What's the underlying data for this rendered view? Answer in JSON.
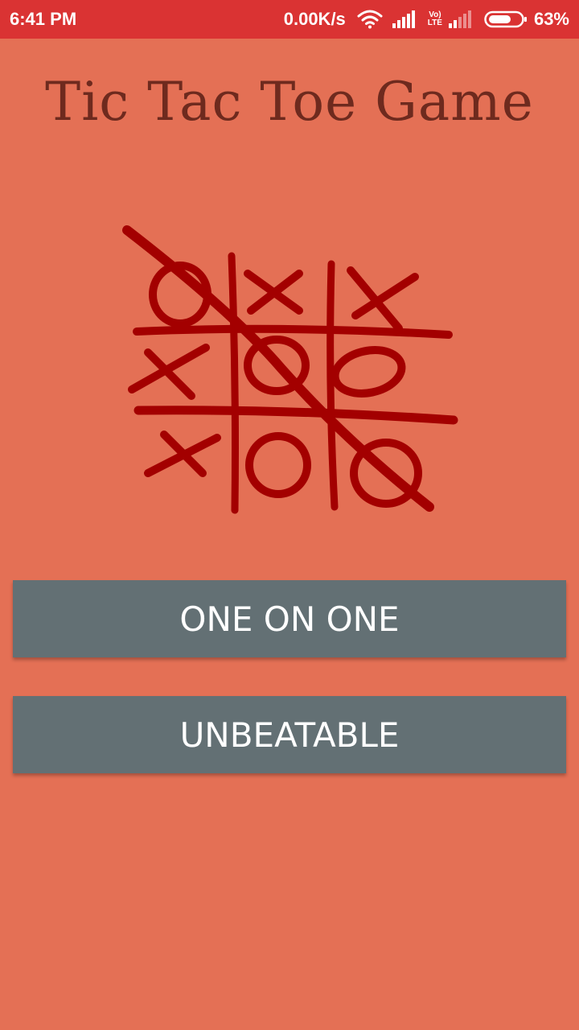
{
  "status_bar": {
    "time": "6:41 PM",
    "net_speed": "0.00K/s",
    "lte_top": "Vo)",
    "lte_bottom": "LTE",
    "battery_percent": "63%",
    "icons": [
      "wifi-icon",
      "signal-icon",
      "lte-icon",
      "signal-2-icon",
      "battery-icon"
    ],
    "background_color": "#DA3333"
  },
  "app": {
    "title": "Tic Tac Toe Game",
    "background_color": "#E47055",
    "title_color": "#6E2A1E"
  },
  "board_illustration": {
    "icon": "tic-tac-toe-board-icon",
    "color": "#A30000",
    "cells": [
      [
        "O",
        "X",
        "X"
      ],
      [
        "X",
        "O",
        "O"
      ],
      [
        "X",
        "O",
        "O"
      ]
    ]
  },
  "menu": {
    "buttons": [
      {
        "label": "ONE ON ONE"
      },
      {
        "label": "UNBEATABLE"
      }
    ],
    "button_color": "#637074"
  }
}
